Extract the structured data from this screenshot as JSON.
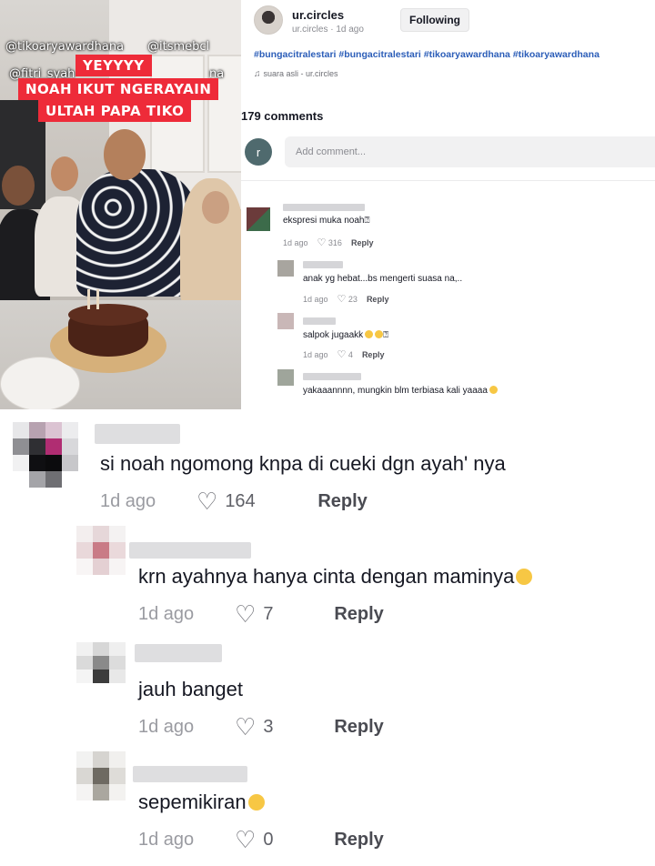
{
  "video": {
    "handles": [
      "@tikoaryawardhana",
      "@itsmebcl",
      "@fitri_syah",
      "na"
    ],
    "caption_lines": [
      "YEYYYY",
      "NOAH IKUT NGERAYAIN",
      "ULTAH PAPA TIKO"
    ],
    "caption_color": "#ee2b39"
  },
  "post": {
    "author_name": "ur.circles",
    "author_sub": "ur.circles · 1d ago",
    "follow_label": "Following",
    "hashtags": "#bungacitralestari #bungacitralestari #tikoaryawardhana #tikoaryawardhana",
    "sound_icon": "music-note-icon",
    "sound": "suara asli - ur.circles",
    "comment_count": "179 comments",
    "me_initial": "r",
    "add_comment_placeholder": "Add comment..."
  },
  "small_comments": [
    {
      "text": "ekspresi muka noah",
      "time": "1d ago",
      "likes": "316",
      "reply": "Reply"
    },
    {
      "text": "anak yg hebat...bs mengerti suasa na,..",
      "time": "1d ago",
      "likes": "23",
      "reply": "Reply"
    },
    {
      "text": "salpok jugaakk",
      "time": "1d ago",
      "likes": "4",
      "reply": "Reply"
    },
    {
      "text": "yakaaannnn, mungkin blm terbiasa kali yaaaa",
      "time": "",
      "likes": "",
      "reply": ""
    }
  ],
  "big_comments": [
    {
      "text": "si noah ngomong knpa di cueki dgn ayah' nya",
      "time": "1d ago",
      "likes": "164",
      "reply": "Reply"
    },
    {
      "text": "krn ayahnya hanya cinta dengan maminya",
      "time": "1d ago",
      "likes": "7",
      "reply": "Reply"
    },
    {
      "text": "jauh banget",
      "time": "1d ago",
      "likes": "3",
      "reply": "Reply"
    },
    {
      "text": "sepemikiran",
      "time": "1d ago",
      "likes": "0",
      "reply": "Reply"
    }
  ],
  "icons": {
    "heart": "heart-outline-icon",
    "emoji": "laughing-emoji-icon"
  },
  "colors": {
    "hashtag": "#2b5db8",
    "text": "#161823",
    "meta": "#9a9ba1"
  }
}
